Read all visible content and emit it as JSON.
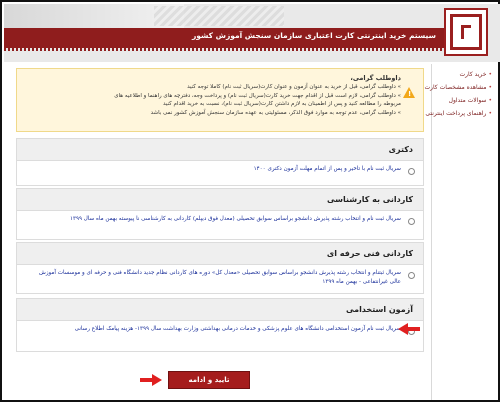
{
  "header": {
    "title": "سیستم خرید اینترنتی کارت اعتباری سازمان سنجش آموزش کشور"
  },
  "sidebar": {
    "items": [
      {
        "label": "خرید کارت"
      },
      {
        "label": "مشاهده مشخصات کارت"
      },
      {
        "label": "سوالات متداول"
      },
      {
        "label": "راهنمای پرداخت اینترنتی"
      }
    ]
  },
  "notice": {
    "title": "داوطلب گرامی،",
    "lines": [
      "» داوطلب گرامی، قبل از خرید به عنوان آزمون و عنوان کارت(سریال ثبت نام) کاملا توجه کنید",
      "» داوطلب گرامی، لازم است قبل از اقدام جهت خرید کارت(سریال ثبت نام) و پرداخت وجه، دفترچه های راهنما و اطلاعیه های",
      "مربوطه را مطالعه کنید و پس از اطمینان به لازم داشتن کارت(سریال ثبت نام)، نسبت به خرید اقدام کنید",
      "» داوطلب گرامی، عدم توجه به موارد فوق الذکر، مسئولیتی به عهده سازمان سنجش آموزش کشور نمی باشد"
    ]
  },
  "sections": [
    {
      "title": "دکتری",
      "option": "سریال ثبت نام با تاخیر و پس از اتمام مهلت آزمون دکتری ۱۴۰۰"
    },
    {
      "title": "کاردانی به کارشناسی",
      "option": "سریال ثبت نام و انتخاب رشته پذیرش دانشجو براساس سوابق تحصیلی (معدل فوق دیپلم) کاردانی به کارشناسی نا پیوسته بهمن ماه سال ۱۳۹۹"
    },
    {
      "title": "کاردانی فنی حرفه ای",
      "option": "سریال ثبتنام و انتخاب رشته پذیرش دانشجو براساس سوابق تحصیلی «معدل کل» دوره های کاردانی نظام جدید دانشگاه فنی و حرفه ای و موسسات آموزش عالی غیرانتفاعی - بهمن ماه ۱۳۹۹"
    },
    {
      "title": "آزمون استخدامی",
      "option": "سریال ثبت نام آزمون استخدامی دانشگاه های علوم پزشکی و خدمات درمانی بهداشتی وزارت بهداشت سال ۱۳۹۹- هزینه پیامک اطلاع رسانی"
    }
  ],
  "confirm_button": {
    "label": "تایید و ادامه"
  },
  "colors": {
    "brand": "#8f1d1d",
    "link": "#1a2f9a",
    "annotation_arrow": "#e02020"
  }
}
